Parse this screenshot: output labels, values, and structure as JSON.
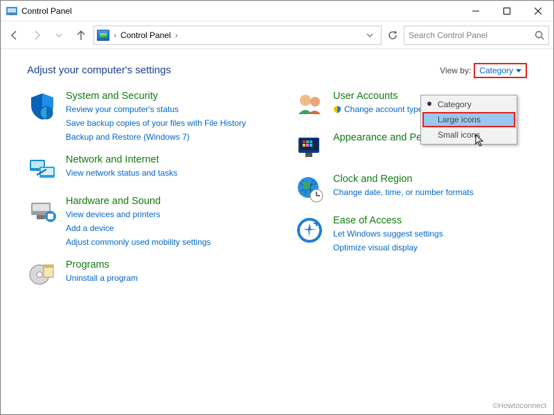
{
  "window": {
    "title": "Control Panel"
  },
  "address": {
    "crumb1": "Control Panel",
    "search_placeholder": "Search Control Panel"
  },
  "heading": "Adjust your computer's settings",
  "viewby": {
    "label": "View by:",
    "current": "Category",
    "options": [
      "Category",
      "Large icons",
      "Small icons"
    ]
  },
  "categories_left": [
    {
      "title": "System and Security",
      "links": [
        "Review your computer's status",
        "Save backup copies of your files with File History",
        "Backup and Restore (Windows 7)"
      ]
    },
    {
      "title": "Network and Internet",
      "links": [
        "View network status and tasks"
      ]
    },
    {
      "title": "Hardware and Sound",
      "links": [
        "View devices and printers",
        "Add a device",
        "Adjust commonly used mobility settings"
      ]
    },
    {
      "title": "Programs",
      "links": [
        "Uninstall a program"
      ]
    }
  ],
  "categories_right": [
    {
      "title": "User Accounts",
      "links": [
        "Change account type"
      ],
      "link_shield": [
        true
      ]
    },
    {
      "title": "Appearance and Personalization",
      "links": []
    },
    {
      "title": "Clock and Region",
      "links": [
        "Change date, time, or number formats"
      ]
    },
    {
      "title": "Ease of Access",
      "links": [
        "Let Windows suggest settings",
        "Optimize visual display"
      ]
    }
  ],
  "watermark": "©Howtoconnect"
}
